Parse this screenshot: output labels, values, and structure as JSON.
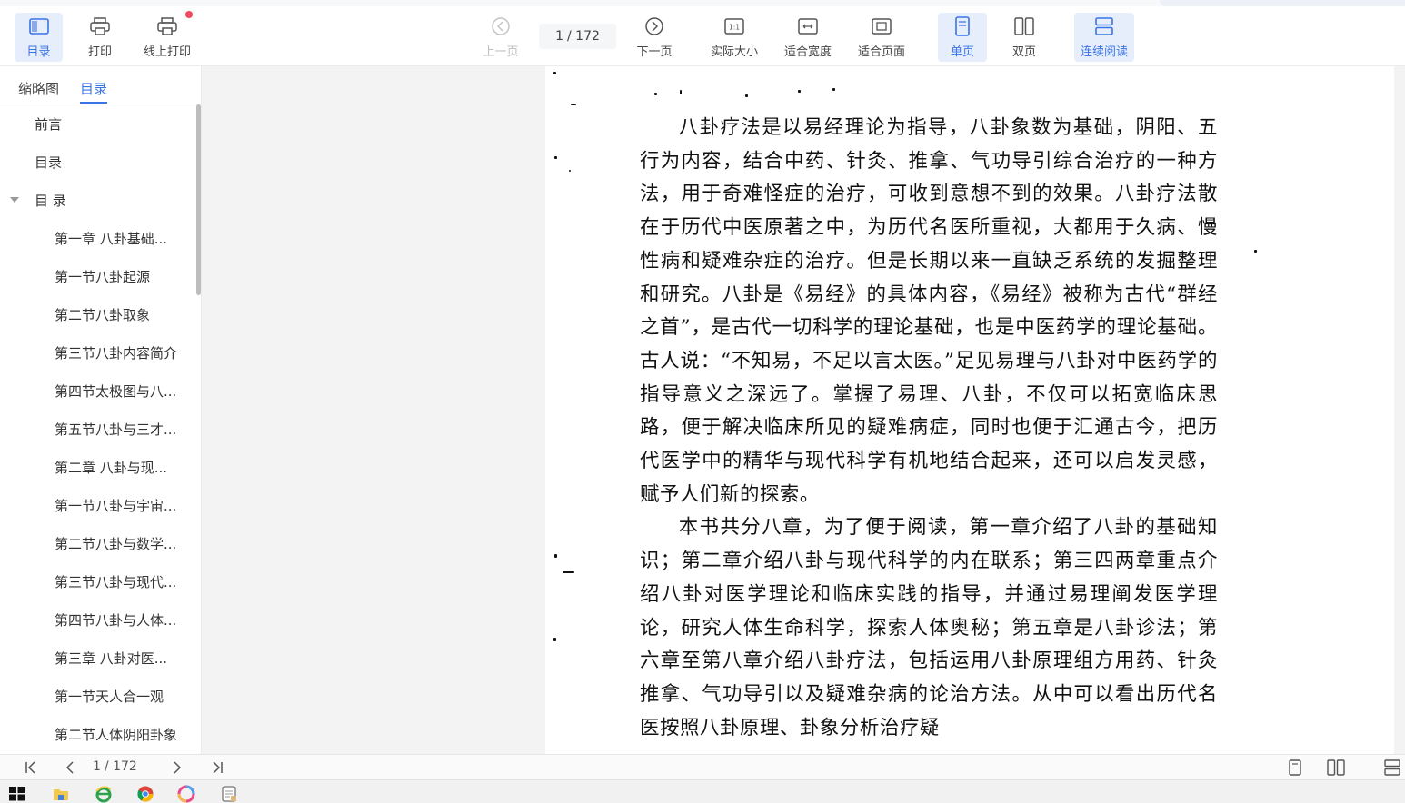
{
  "toolbar": {
    "toc_label": "目录",
    "print_label": "打印",
    "online_print_label": "线上打印",
    "prev_label": "上一页",
    "page_current": "1",
    "page_total": "/ 172",
    "next_label": "下一页",
    "actual_size_label": "实际大小",
    "fit_width_label": "适合宽度",
    "fit_page_label": "适合页面",
    "single_label": "单页",
    "double_label": "双页",
    "continuous_label": "连续阅读",
    "actual_size_glyph": "1:1"
  },
  "sidebar": {
    "tabs": [
      "缩略图",
      "目录"
    ],
    "active_tab": 1,
    "items": [
      {
        "label": "前言",
        "level": 1
      },
      {
        "label": "目录",
        "level": 1
      },
      {
        "label": "目 录",
        "level": 1,
        "expanded": true
      },
      {
        "label": "第一章 八卦基础...",
        "level": 2
      },
      {
        "label": "第一节八卦起源",
        "level": 2
      },
      {
        "label": "第二节八卦取象",
        "level": 2
      },
      {
        "label": "第三节八卦内容简介",
        "level": 2
      },
      {
        "label": "第四节太极图与八...",
        "level": 2
      },
      {
        "label": "第五节八卦与三才...",
        "level": 2
      },
      {
        "label": "第二章 八卦与现...",
        "level": 2
      },
      {
        "label": "第一节八卦与宇宙...",
        "level": 2
      },
      {
        "label": "第二节八卦与数学...",
        "level": 2
      },
      {
        "label": "第三节八卦与现代...",
        "level": 2
      },
      {
        "label": "第四节八卦与人体...",
        "level": 2
      },
      {
        "label": "第三章 八卦对医...",
        "level": 2
      },
      {
        "label": "第一节天人合一观",
        "level": 2
      },
      {
        "label": "第二节人体阴阳卦象",
        "level": 2
      }
    ]
  },
  "document": {
    "paragraphs": [
      "八卦疗法是以易经理论为指导，八卦象数为基础，阴阳、五行为内容，结合中药、针灸、推拿、气功导引综合治疗的一种方法，用于奇难怪症的治疗，可收到意想不到的效果。八卦疗法散在于历代中医原著之中，为历代名医所重视，大都用于久病、慢性病和疑难杂症的治疗。但是长期以来一直缺乏系统的发掘整理和研究。八卦是《易经》的具体内容，《易经》被称为古代“群经之首”，是古代一切科学的理论基础，也是中医药学的理论基础。古人说：“不知易，不足以言太医。”足见易理与八卦对中医药学的指导意义之深远了。掌握了易理、八卦，不仅可以拓宽临床思路，便于解决临床所见的疑难病症，同时也便于汇通古今，把历代医学中的精华与现代科学有机地结合起来，还可以启发灵感，赋予人们新的探索。",
      "本书共分八章，为了便于阅读，第一章介绍了八卦的基础知识；第二章介绍八卦与现代科学的内在联系；第三四两章重点介绍八卦对医学理论和临床实践的指导，并通过易理阐发医学理论，研究人体生命科学，探索人体奥秘；第五章是八卦诊法；第六章至第八章介绍八卦疗法，包括运用八卦原理组方用药、针灸推拿、气功导引以及疑难杂病的论治方法。从中可以看出历代名医按照八卦原理、卦象分析治疗疑"
    ]
  },
  "bottombar": {
    "page_current": "1",
    "page_total": "/ 172"
  },
  "colors": {
    "accent": "#3a74e6",
    "active_bg": "#e6eefc",
    "badge": "#f24a5a"
  }
}
